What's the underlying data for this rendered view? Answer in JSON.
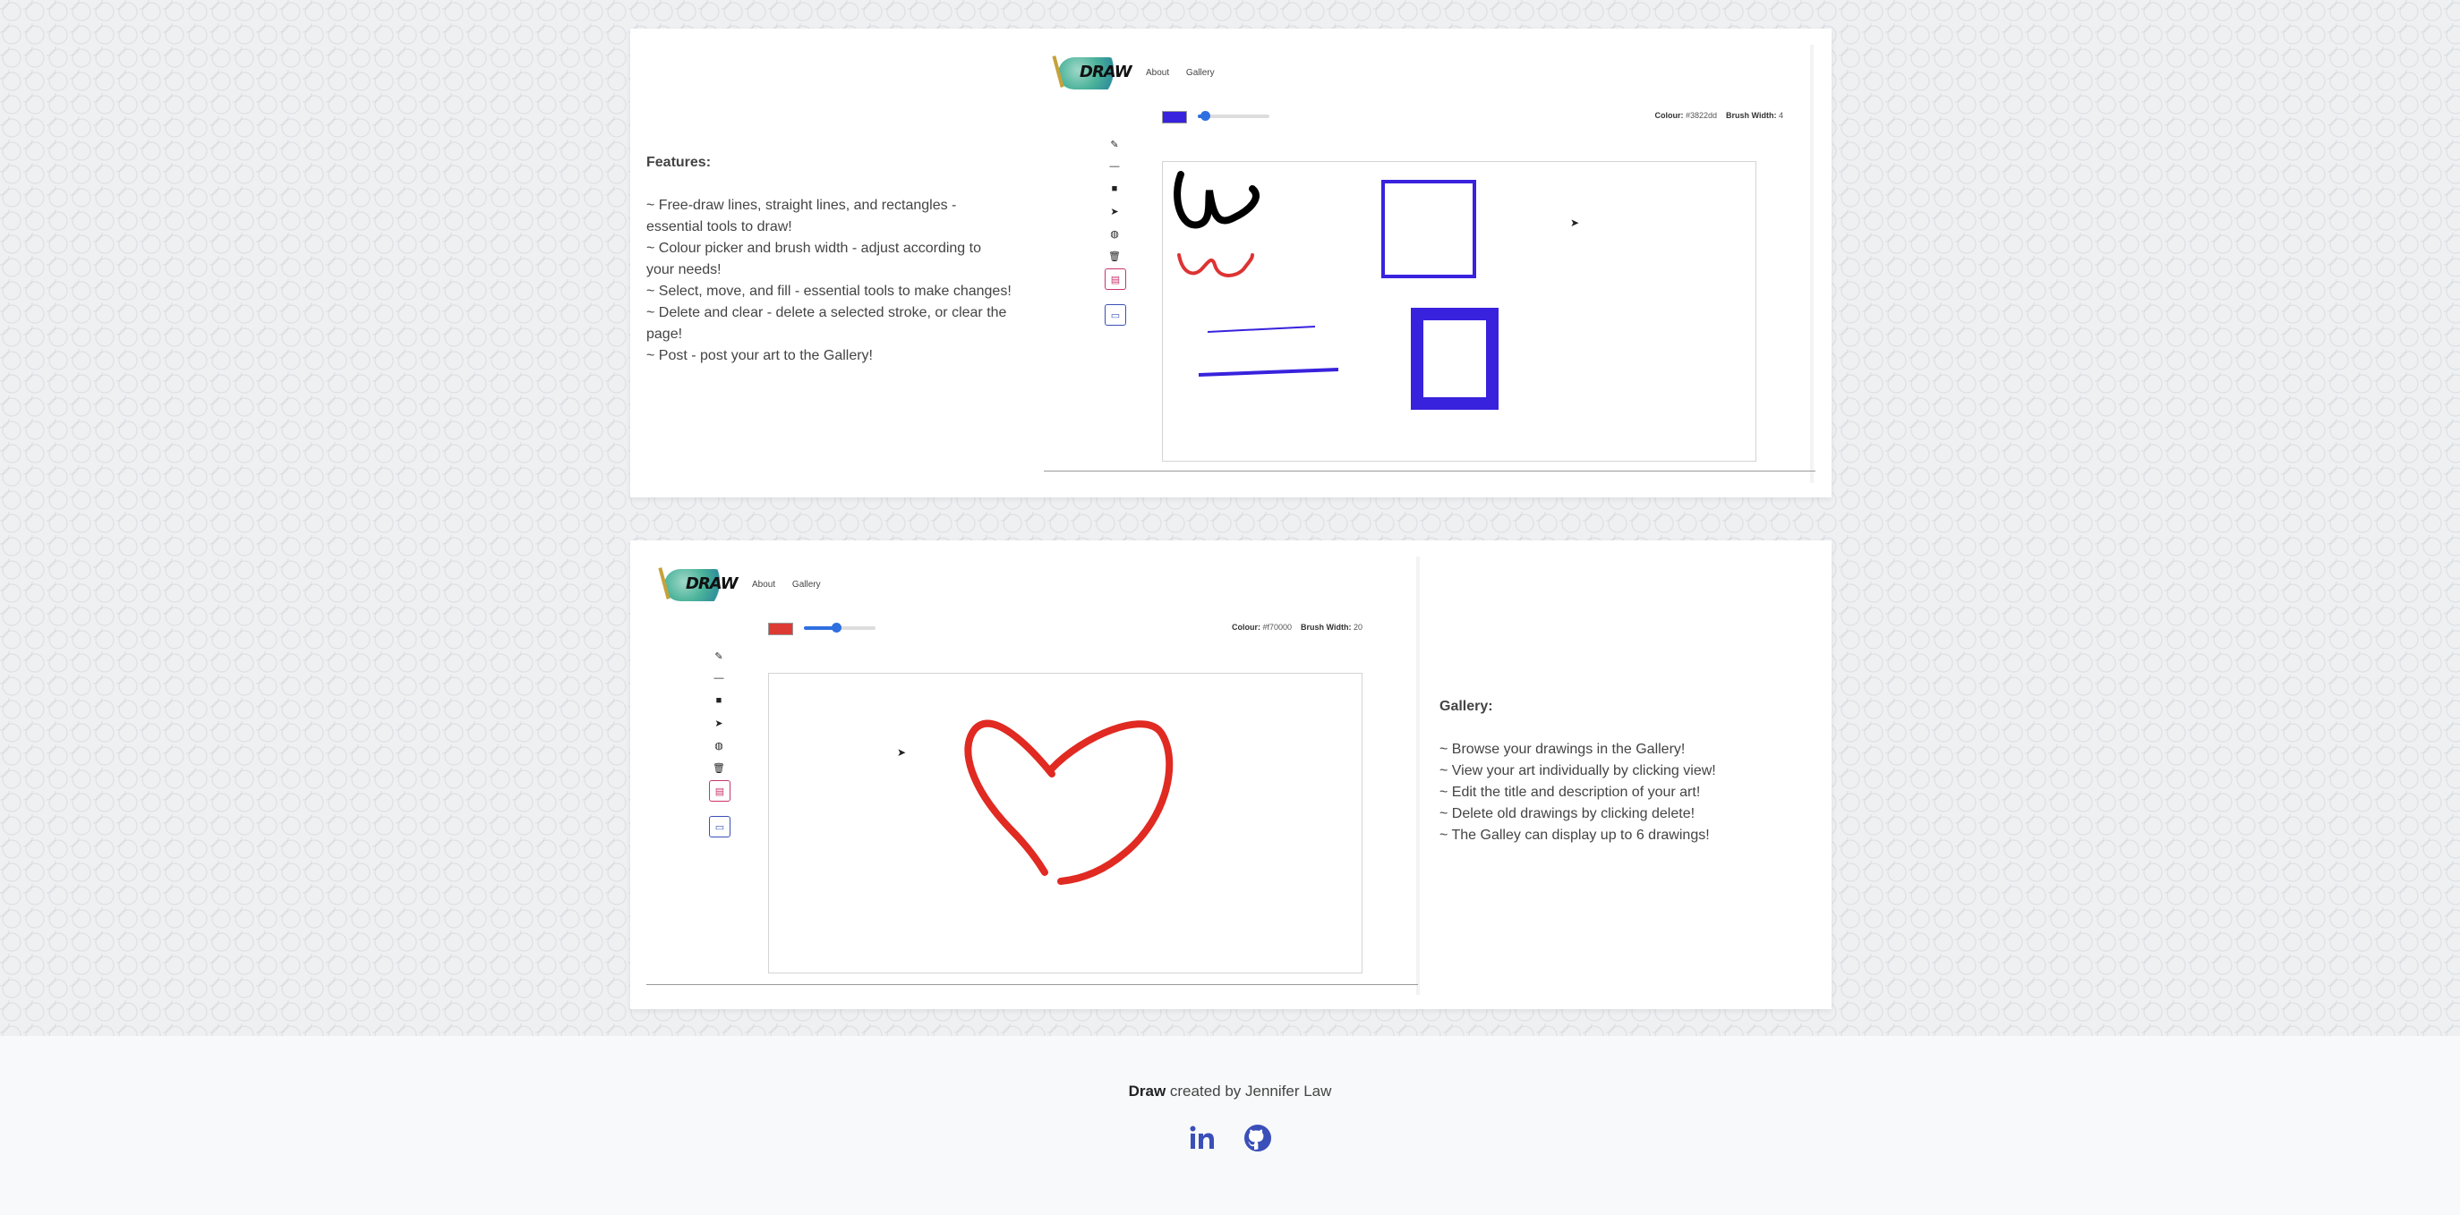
{
  "features": {
    "title": "Features:",
    "lines": [
      "~ Free-draw lines, straight lines, and rectangles -",
      "essential tools to draw!",
      "~ Colour picker and brush width - adjust according to",
      "your needs!",
      "~ Select, move, and fill - essential tools to make changes!",
      "~ Delete and clear - delete a selected stroke, or clear the",
      "page!",
      "~ Post - post your art to the Gallery!"
    ]
  },
  "gallery": {
    "title": "Gallery:",
    "lines": [
      "~ Browse your drawings in the Gallery!",
      "~ View your art individually by clicking view!",
      "~ Edit the title and description of your art!",
      "~ Delete old drawings by clicking delete!",
      "~ The Galley can display up to 6 drawings!"
    ]
  },
  "app": {
    "logo_text": "DRAW",
    "nav": {
      "about": "About",
      "gallery": "Gallery"
    },
    "tools": [
      "pencil-icon",
      "line-icon",
      "rectangle-icon",
      "select-icon",
      "fill-icon",
      "trash-icon",
      "post-icon",
      "clear-icon"
    ]
  },
  "screen1": {
    "colour_label": "Colour:",
    "colour_value": "#3822dd",
    "brush_label": "Brush Width:",
    "brush_value": "4",
    "swatch_color": "#3822dd",
    "slider_fraction": 0.1
  },
  "screen2": {
    "colour_label": "Colour:",
    "colour_value": "#f70000",
    "brush_label": "Brush Width:",
    "brush_value": "20",
    "swatch_color": "#dd3a33",
    "slider_fraction": 0.45
  },
  "footer": {
    "brand": "Draw",
    "credit": " created by Jennifer Law",
    "links": [
      "linkedin-icon",
      "github-icon"
    ],
    "icon_color": "#3a4fb8"
  }
}
